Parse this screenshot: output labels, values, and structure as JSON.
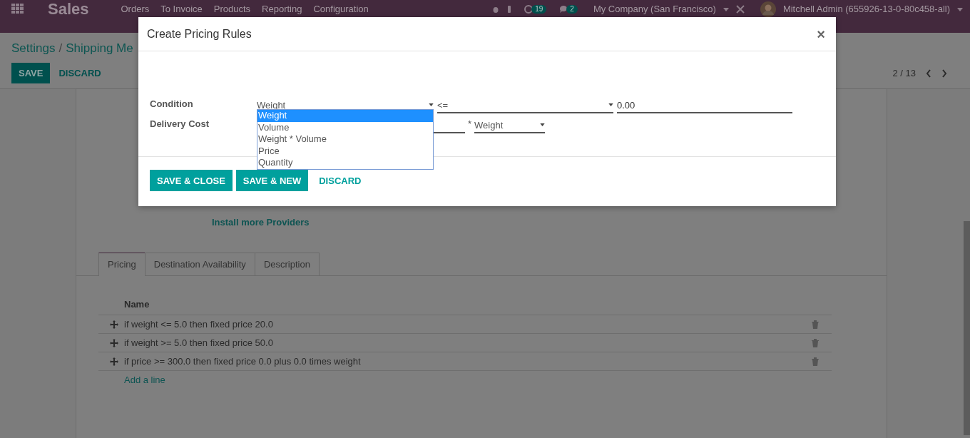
{
  "navbar": {
    "app_name": "Sales",
    "menu": [
      "Orders",
      "To Invoice",
      "Products",
      "Reporting",
      "Configuration"
    ],
    "activity_count": "19",
    "message_count": "2",
    "company": "My Company (San Francisco)",
    "user": "Mitchell Admin (655926-13-0-80c458-all)"
  },
  "breadcrumb": [
    "Settings",
    "Shipping Me"
  ],
  "breadcrumb_separator": "/",
  "form_buttons": [
    {
      "label": "SAVE",
      "kind": "primary"
    },
    {
      "label": "DISCARD",
      "kind": "link"
    }
  ],
  "pager": "2 / 13",
  "install_link": "Install more Providers",
  "tabs": [
    {
      "label": "Pricing",
      "selected": true
    },
    {
      "label": "Destination Availability",
      "selected": false
    },
    {
      "label": "Description",
      "selected": false
    }
  ],
  "table": {
    "columns": [
      "Name"
    ],
    "rows": [
      {
        "name": "if weight <= 5.0 then fixed price 20.0"
      },
      {
        "name": "if weight >= 5.0 then fixed price 50.0"
      },
      {
        "name": "if price >= 300.0 then fixed price 0.0 plus 0.0 times weight"
      }
    ],
    "add_line": "Add a line"
  },
  "dialog": {
    "title": "Create Pricing Rules",
    "close": "×",
    "condition": {
      "label": "Condition",
      "variable": "Weight",
      "operator": "<=",
      "value": "0.00"
    },
    "delivery_cost": {
      "label": "Delivery Cost",
      "times": "*",
      "variable": "Weight"
    },
    "dropdown_options": [
      {
        "label": "Weight",
        "selected": true
      },
      {
        "label": "Volume",
        "selected": false
      },
      {
        "label": "Weight * Volume",
        "selected": false
      },
      {
        "label": "Price",
        "selected": false
      },
      {
        "label": "Quantity",
        "selected": false
      }
    ],
    "buttons": [
      {
        "label": "SAVE & CLOSE",
        "kind": "primary"
      },
      {
        "label": "SAVE & NEW",
        "kind": "primary"
      },
      {
        "label": "DISCARD",
        "kind": "link"
      }
    ]
  }
}
